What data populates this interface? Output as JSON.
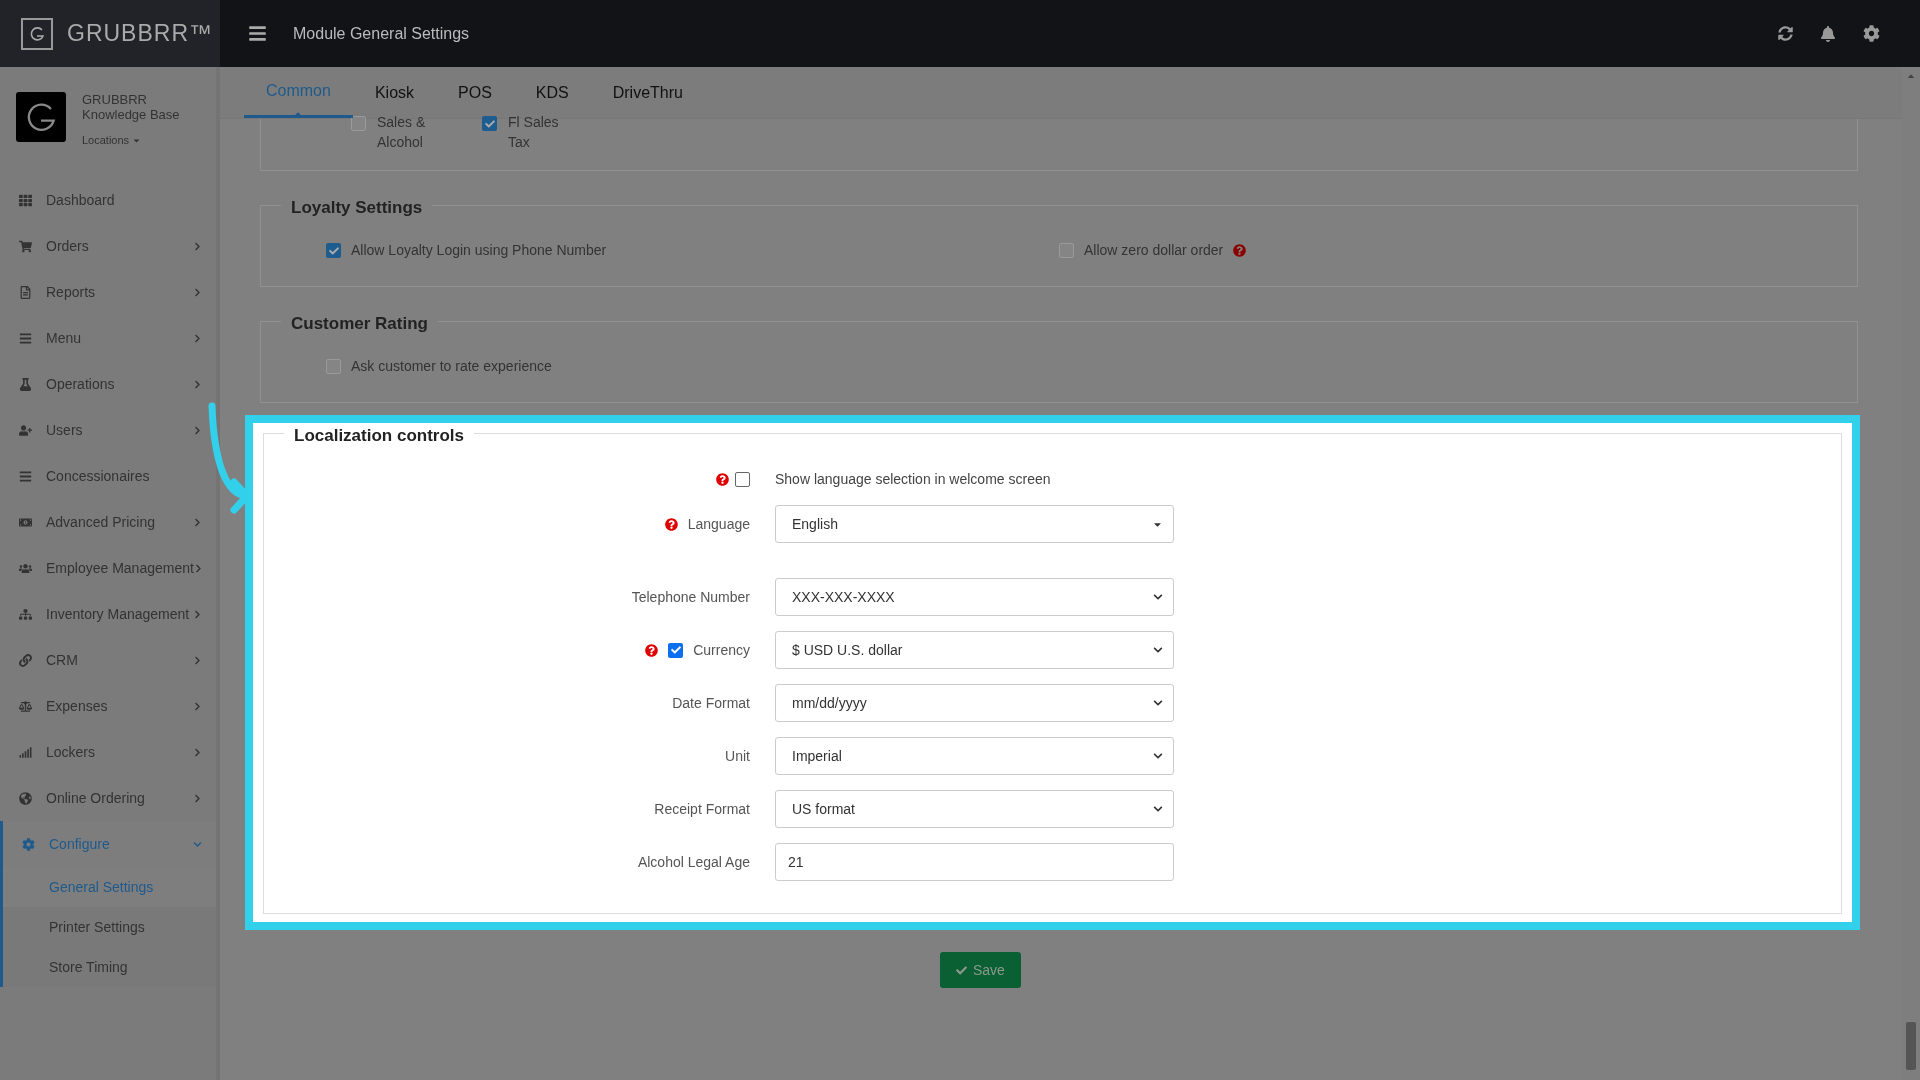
{
  "app": {
    "brand": "GRUBBRR™",
    "page_title": "Module General Settings"
  },
  "account": {
    "name": "GRUBBRR Knowledge Base",
    "locations": "Locations"
  },
  "sidebar": {
    "items": [
      {
        "label": "Dashboard",
        "kind": "link",
        "selected": false
      },
      {
        "label": "Orders",
        "kind": "group",
        "expanded": false,
        "selected": false
      },
      {
        "label": "Reports",
        "kind": "group",
        "expanded": false,
        "selected": false
      },
      {
        "label": "Menu",
        "kind": "group",
        "expanded": false,
        "selected": false
      },
      {
        "label": "Operations",
        "kind": "group",
        "expanded": false,
        "selected": false
      },
      {
        "label": "Users",
        "kind": "group",
        "expanded": false,
        "selected": false
      },
      {
        "label": "Concessionaires",
        "kind": "link",
        "selected": false
      },
      {
        "label": "Advanced Pricing",
        "kind": "group",
        "expanded": false,
        "selected": false
      },
      {
        "label": "Employee Management",
        "kind": "group",
        "expanded": false,
        "selected": false
      },
      {
        "label": "Inventory Management",
        "kind": "group",
        "expanded": false,
        "selected": false
      },
      {
        "label": "CRM",
        "kind": "group",
        "expanded": false,
        "selected": false
      },
      {
        "label": "Expenses",
        "kind": "group",
        "expanded": false,
        "selected": false
      },
      {
        "label": "Lockers",
        "kind": "group",
        "expanded": false,
        "selected": false
      },
      {
        "label": "Online Ordering",
        "kind": "group",
        "expanded": false,
        "selected": false
      },
      {
        "label": "Configure",
        "kind": "group",
        "expanded": true,
        "selected": true,
        "children": [
          {
            "label": "General Settings",
            "selected": true
          },
          {
            "label": "Printer Settings",
            "selected": false
          },
          {
            "label": "Store Timing",
            "selected": false
          }
        ]
      }
    ]
  },
  "tabs": [
    {
      "label": "Common",
      "selected": true
    },
    {
      "label": "Kiosk",
      "selected": false
    },
    {
      "label": "POS",
      "selected": false
    },
    {
      "label": "KDS",
      "selected": false
    },
    {
      "label": "DriveThru",
      "selected": false
    }
  ],
  "tax_section": {
    "options": [
      {
        "label": "Sales & Alcohol",
        "checked": false
      },
      {
        "label": "Fl Sales Tax",
        "checked": true
      }
    ]
  },
  "loyalty": {
    "title": "Loyalty Settings",
    "options": [
      {
        "label": "Allow Loyalty Login using Phone Number",
        "checked": true,
        "help": false
      },
      {
        "label": "Allow zero dollar order",
        "checked": false,
        "help": true
      }
    ]
  },
  "customer_rating": {
    "title": "Customer Rating",
    "options": [
      {
        "label": "Ask customer to rate experience",
        "checked": false,
        "help": false
      }
    ]
  },
  "localization": {
    "title": "Localization controls",
    "language_toggle": {
      "label": "Show language selection in welcome screen",
      "checked": false,
      "help": true
    },
    "fields": [
      {
        "label": "Language",
        "kind": "dropdown",
        "value": "English",
        "help": true
      },
      {
        "label": "Telephone Number",
        "kind": "select",
        "value": "XXX-XXX-XXXX",
        "help": false
      },
      {
        "label": "Currency",
        "kind": "select",
        "value": "$ USD U.S. dollar",
        "help": true,
        "checked": true
      },
      {
        "label": "Date Format",
        "kind": "select",
        "value": "mm/dd/yyyy",
        "help": false
      },
      {
        "label": "Unit",
        "kind": "select",
        "value": "Imperial",
        "help": false
      },
      {
        "label": "Receipt Format",
        "kind": "select",
        "value": "US format",
        "help": false
      },
      {
        "label": "Alcohol Legal Age",
        "kind": "input",
        "value": "21",
        "help": false
      }
    ]
  },
  "save_button": {
    "label": "Save"
  }
}
